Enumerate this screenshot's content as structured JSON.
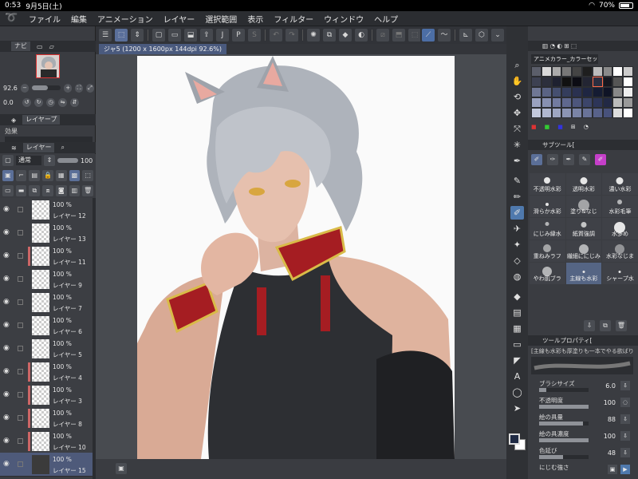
{
  "status": {
    "time": "0:53",
    "date": "9月5日(土)",
    "battery": "70%",
    "wifi_icon": "wifi-icon"
  },
  "menu": {
    "items": [
      "ファイル",
      "編集",
      "アニメーション",
      "レイヤー",
      "選択範囲",
      "表示",
      "フィルター",
      "ウィンドウ",
      "ヘルプ"
    ]
  },
  "navigator": {
    "tabs": [
      "ナビ"
    ],
    "zoom": "92.6",
    "rotation": "0.0"
  },
  "layer_props": {
    "tab": "レイヤープ",
    "effect_label": "効果"
  },
  "layer_panel": {
    "tab": "レイヤー",
    "blend_mode": "通常",
    "opacity": "100"
  },
  "layers": [
    {
      "opacity": "100 %",
      "name": "レイヤー 12"
    },
    {
      "opacity": "100 %",
      "name": "レイヤー 13"
    },
    {
      "opacity": "100 %",
      "name": "レイヤー 11"
    },
    {
      "opacity": "100 %",
      "name": "レイヤー 9"
    },
    {
      "opacity": "100 %",
      "name": "レイヤー 7"
    },
    {
      "opacity": "100 %",
      "name": "レイヤー 6"
    },
    {
      "opacity": "100 %",
      "name": "レイヤー 5"
    },
    {
      "opacity": "100 %",
      "name": "レイヤー 4"
    },
    {
      "opacity": "100 %",
      "name": "レイヤー 3"
    },
    {
      "opacity": "100 %",
      "name": "レイヤー 8"
    },
    {
      "opacity": "100 %",
      "name": "レイヤー 10"
    },
    {
      "opacity": "100 %",
      "name": "レイヤー 15"
    }
  ],
  "canvas": {
    "tab_title": "ジャ5 (1200 x 1600px 144dpi 92.6%)"
  },
  "colorset": {
    "selector": "アニメカラー_カラーセッ"
  },
  "subtool": {
    "tab": "サブツール["
  },
  "brushes": [
    {
      "name": "不透明水彩"
    },
    {
      "name": "透明水彩"
    },
    {
      "name": "濃い水彩"
    },
    {
      "name": "滑らか水彩"
    },
    {
      "name": "塗り&なじ"
    },
    {
      "name": "水彩毛筆"
    },
    {
      "name": "にじみ縁水"
    },
    {
      "name": "紙質強調"
    },
    {
      "name": "水多め"
    },
    {
      "name": "重ねみラフ"
    },
    {
      "name": "繊細ににじみ"
    },
    {
      "name": "水彩なじま"
    },
    {
      "name": "やわ肌ブラ"
    },
    {
      "name": "主線も水彩"
    },
    {
      "name": "シャープ水"
    }
  ],
  "tool_property": {
    "tab": "ツールプロパティ[",
    "name": "[主線も水彩も厚塗りも一本でやる欲ばりのブラシ]",
    "brush_size": {
      "label": "ブラシサイズ",
      "value": "6.0",
      "level": 0.15
    },
    "opacity": {
      "label": "不透明度",
      "value": "100",
      "level": 1.0
    },
    "paint_amount": {
      "label": "絵の具量",
      "value": "88",
      "level": 0.88
    },
    "paint_density": {
      "label": "絵の具濃度",
      "value": "100",
      "level": 1.0
    },
    "color_stretch": {
      "label": "色延び",
      "value": "48",
      "level": 0.48
    },
    "blur": {
      "label": "にじむ強さ"
    }
  },
  "colors": {
    "accent": "#4f79ad",
    "main_color": "#1f2a44",
    "sub_color": "#ffffff"
  }
}
